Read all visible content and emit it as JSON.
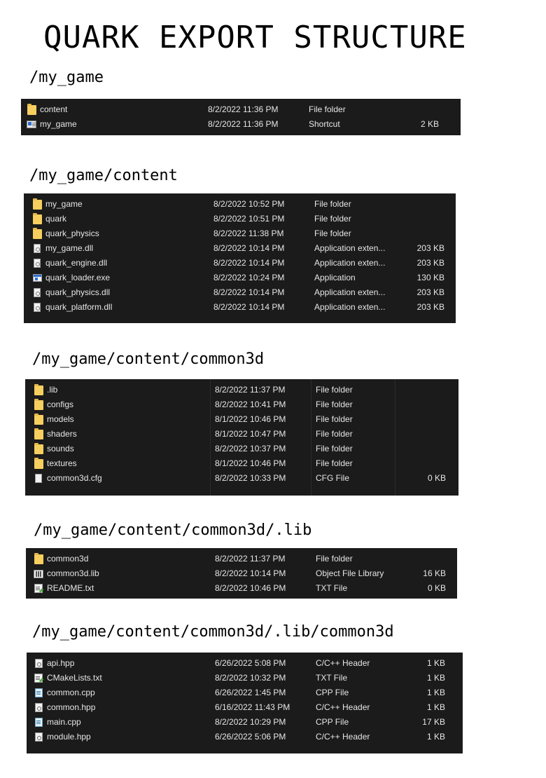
{
  "title": "QUARK EXPORT STRUCTURE",
  "sections": [
    {
      "path": "/my_game",
      "rows": [
        {
          "name": "content",
          "date": "8/2/2022 11:36 PM",
          "type": "File folder",
          "size": "",
          "icon": "folder-icon"
        },
        {
          "name": "my_game",
          "date": "8/2/2022 11:36 PM",
          "type": "Shortcut",
          "size": "2 KB",
          "icon": "shortcut-icon"
        }
      ]
    },
    {
      "path": "/my_game/content",
      "rows": [
        {
          "name": "my_game",
          "date": "8/2/2022 10:52 PM",
          "type": "File folder",
          "size": "",
          "icon": "folder-icon"
        },
        {
          "name": "quark",
          "date": "8/2/2022 10:51 PM",
          "type": "File folder",
          "size": "",
          "icon": "folder-icon"
        },
        {
          "name": "quark_physics",
          "date": "8/2/2022 11:38 PM",
          "type": "File folder",
          "size": "",
          "icon": "folder-icon"
        },
        {
          "name": "my_game.dll",
          "date": "8/2/2022 10:14 PM",
          "type": "Application exten...",
          "size": "203 KB",
          "icon": "dll-icon"
        },
        {
          "name": "quark_engine.dll",
          "date": "8/2/2022 10:14 PM",
          "type": "Application exten...",
          "size": "203 KB",
          "icon": "dll-icon"
        },
        {
          "name": "quark_loader.exe",
          "date": "8/2/2022 10:24 PM",
          "type": "Application",
          "size": "130 KB",
          "icon": "exe-icon"
        },
        {
          "name": "quark_physics.dll",
          "date": "8/2/2022 10:14 PM",
          "type": "Application exten...",
          "size": "203 KB",
          "icon": "dll-icon"
        },
        {
          "name": "quark_platform.dll",
          "date": "8/2/2022 10:14 PM",
          "type": "Application exten...",
          "size": "203 KB",
          "icon": "dll-icon"
        }
      ]
    },
    {
      "path": "/my_game/content/common3d",
      "rows": [
        {
          "name": ".lib",
          "date": "8/2/2022 11:37 PM",
          "type": "File folder",
          "size": "",
          "icon": "folder-icon"
        },
        {
          "name": "configs",
          "date": "8/2/2022 10:41 PM",
          "type": "File folder",
          "size": "",
          "icon": "folder-icon"
        },
        {
          "name": "models",
          "date": "8/1/2022 10:46 PM",
          "type": "File folder",
          "size": "",
          "icon": "folder-icon"
        },
        {
          "name": "shaders",
          "date": "8/1/2022 10:47 PM",
          "type": "File folder",
          "size": "",
          "icon": "folder-icon"
        },
        {
          "name": "sounds",
          "date": "8/2/2022 10:37 PM",
          "type": "File folder",
          "size": "",
          "icon": "folder-icon"
        },
        {
          "name": "textures",
          "date": "8/1/2022 10:46 PM",
          "type": "File folder",
          "size": "",
          "icon": "folder-icon"
        },
        {
          "name": "common3d.cfg",
          "date": "8/2/2022 10:33 PM",
          "type": "CFG File",
          "size": "0 KB",
          "icon": "file-icon"
        }
      ]
    },
    {
      "path": "/my_game/content/common3d/.lib",
      "rows": [
        {
          "name": "common3d",
          "date": "8/2/2022 11:37 PM",
          "type": "File folder",
          "size": "",
          "icon": "folder-icon"
        },
        {
          "name": "common3d.lib",
          "date": "8/2/2022 10:14 PM",
          "type": "Object File Library",
          "size": "16 KB",
          "icon": "library-icon"
        },
        {
          "name": "README.txt",
          "date": "8/2/2022 10:46 PM",
          "type": "TXT File",
          "size": "0 KB",
          "icon": "text-file-icon"
        }
      ]
    },
    {
      "path": "/my_game/content/common3d/.lib/common3d",
      "rows": [
        {
          "name": "api.hpp",
          "date": "6/26/2022 5:08 PM",
          "type": "C/C++ Header",
          "size": "1 KB",
          "icon": "header-file-icon"
        },
        {
          "name": "CMakeLists.txt",
          "date": "8/2/2022 10:32 PM",
          "type": "TXT File",
          "size": "1 KB",
          "icon": "text-file-icon"
        },
        {
          "name": "common.cpp",
          "date": "6/26/2022 1:45 PM",
          "type": "CPP File",
          "size": "1 KB",
          "icon": "cpp-file-icon"
        },
        {
          "name": "common.hpp",
          "date": "6/16/2022 11:43 PM",
          "type": "C/C++ Header",
          "size": "1 KB",
          "icon": "header-file-icon"
        },
        {
          "name": "main.cpp",
          "date": "8/2/2022 10:29 PM",
          "type": "CPP File",
          "size": "17 KB",
          "icon": "cpp-file-icon"
        },
        {
          "name": "module.hpp",
          "date": "6/26/2022 5:06 PM",
          "type": "C/C++ Header",
          "size": "1 KB",
          "icon": "header-file-icon"
        }
      ]
    }
  ]
}
